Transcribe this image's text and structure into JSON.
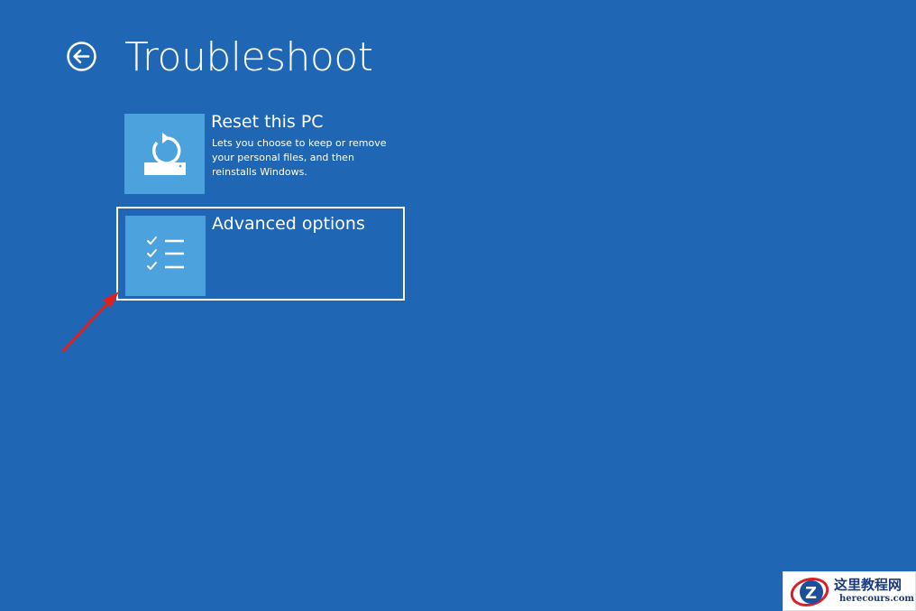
{
  "header": {
    "back_icon": "back-arrow-circle-icon",
    "title": "Troubleshoot"
  },
  "options": [
    {
      "title": "Reset this PC",
      "description": "Lets you choose to keep or remove your personal files, and then reinstalls Windows.",
      "icon": "reset-pc-icon",
      "selected": false
    },
    {
      "title": "Advanced options",
      "description": "",
      "icon": "checklist-icon",
      "selected": true
    }
  ],
  "annotation": {
    "icon": "red-arrow-icon",
    "color": "#e0201c"
  },
  "watermark": {
    "chinese_text": "这里教程网",
    "url": "herecours.com"
  },
  "colors": {
    "background": "#1f66b5",
    "tile": "#4ca2dd",
    "text": "#ffffff",
    "selection_border": "#ffffff"
  }
}
